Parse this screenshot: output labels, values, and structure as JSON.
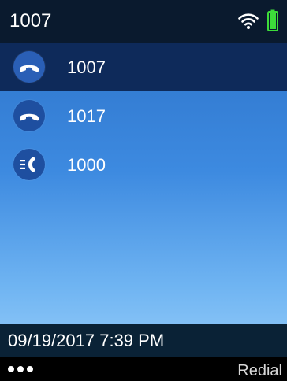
{
  "status_bar": {
    "line_number": "1007",
    "icons": [
      "wifi-icon",
      "battery-icon"
    ],
    "battery_color": "#3ddc3a"
  },
  "recents": {
    "items": [
      {
        "label": "1007",
        "icon": "handset-icon",
        "selected": true
      },
      {
        "label": "1017",
        "icon": "handset-icon",
        "selected": false
      },
      {
        "label": "1000",
        "icon": "voicemail-handset-icon",
        "selected": false
      }
    ]
  },
  "footer": {
    "datetime": "09/19/2017 7:39 PM"
  },
  "softkeys": {
    "more_icon": "more-dots-icon",
    "redial_label": "Redial"
  },
  "colors": {
    "top_bar": "#0a1a2e",
    "selected_row": "#0e2a5a",
    "icon_circle": "#1e4fa0",
    "gradient_top": "#2a6fc6",
    "gradient_bottom": "#9fd3fb"
  }
}
